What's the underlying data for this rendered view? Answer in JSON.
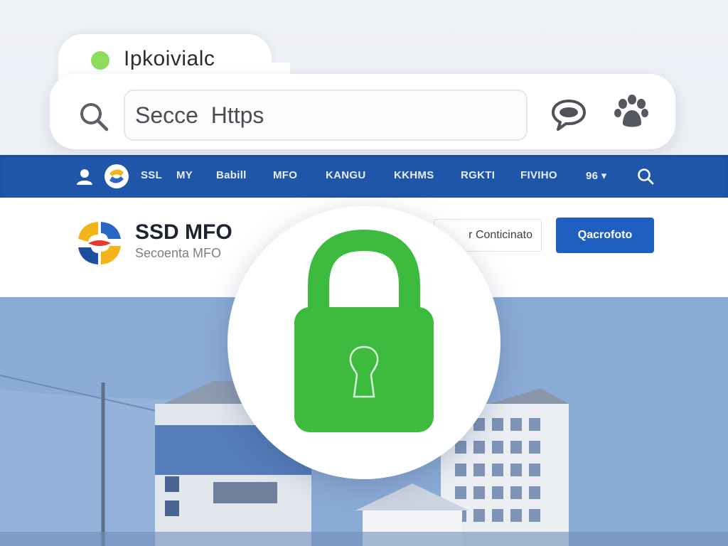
{
  "browser": {
    "tab_title": "Ipkoivialc",
    "url_value": "Secce  Https",
    "tab_status_color": "#8ddc5c"
  },
  "icons": {
    "search": "search-icon",
    "chat": "chat-icon",
    "extension": "paw-icon",
    "user": "user-icon",
    "logo": "brand-logo-icon",
    "lock": "lock-icon"
  },
  "nav": {
    "items": [
      "SSL",
      "MY",
      "Babill",
      "MFO",
      "KANGU",
      "KKHMS",
      "RGKTI",
      "FIVIHO",
      "96 ▾"
    ]
  },
  "header": {
    "brand_name": "SSD MFO",
    "brand_tagline": "Secoenta MFO",
    "link_label": "r Conticinato",
    "button_label": "Qacrofoto"
  },
  "colors": {
    "nav_bg": "#1f56a9",
    "primary_button": "#1f5fc0",
    "lock_green": "#3dbb3f",
    "hero_bg": "#7a9fd2"
  }
}
